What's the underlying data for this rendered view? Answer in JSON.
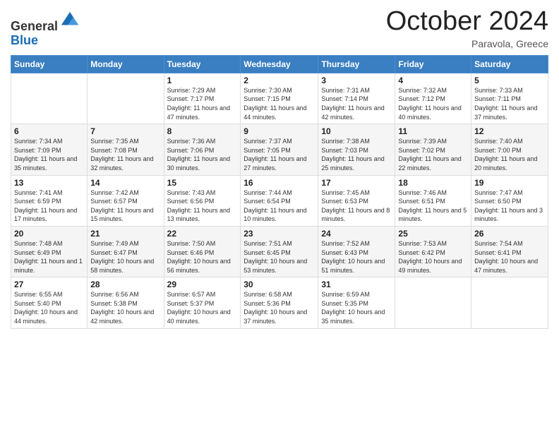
{
  "header": {
    "logo_line1": "General",
    "logo_line2": "Blue",
    "month_title": "October 2024",
    "location": "Paravola, Greece"
  },
  "days_of_week": [
    "Sunday",
    "Monday",
    "Tuesday",
    "Wednesday",
    "Thursday",
    "Friday",
    "Saturday"
  ],
  "weeks": [
    [
      {
        "day": "",
        "info": ""
      },
      {
        "day": "",
        "info": ""
      },
      {
        "day": "1",
        "info": "Sunrise: 7:29 AM\nSunset: 7:17 PM\nDaylight: 11 hours and 47 minutes."
      },
      {
        "day": "2",
        "info": "Sunrise: 7:30 AM\nSunset: 7:15 PM\nDaylight: 11 hours and 44 minutes."
      },
      {
        "day": "3",
        "info": "Sunrise: 7:31 AM\nSunset: 7:14 PM\nDaylight: 11 hours and 42 minutes."
      },
      {
        "day": "4",
        "info": "Sunrise: 7:32 AM\nSunset: 7:12 PM\nDaylight: 11 hours and 40 minutes."
      },
      {
        "day": "5",
        "info": "Sunrise: 7:33 AM\nSunset: 7:11 PM\nDaylight: 11 hours and 37 minutes."
      }
    ],
    [
      {
        "day": "6",
        "info": "Sunrise: 7:34 AM\nSunset: 7:09 PM\nDaylight: 11 hours and 35 minutes."
      },
      {
        "day": "7",
        "info": "Sunrise: 7:35 AM\nSunset: 7:08 PM\nDaylight: 11 hours and 32 minutes."
      },
      {
        "day": "8",
        "info": "Sunrise: 7:36 AM\nSunset: 7:06 PM\nDaylight: 11 hours and 30 minutes."
      },
      {
        "day": "9",
        "info": "Sunrise: 7:37 AM\nSunset: 7:05 PM\nDaylight: 11 hours and 27 minutes."
      },
      {
        "day": "10",
        "info": "Sunrise: 7:38 AM\nSunset: 7:03 PM\nDaylight: 11 hours and 25 minutes."
      },
      {
        "day": "11",
        "info": "Sunrise: 7:39 AM\nSunset: 7:02 PM\nDaylight: 11 hours and 22 minutes."
      },
      {
        "day": "12",
        "info": "Sunrise: 7:40 AM\nSunset: 7:00 PM\nDaylight: 11 hours and 20 minutes."
      }
    ],
    [
      {
        "day": "13",
        "info": "Sunrise: 7:41 AM\nSunset: 6:59 PM\nDaylight: 11 hours and 17 minutes."
      },
      {
        "day": "14",
        "info": "Sunrise: 7:42 AM\nSunset: 6:57 PM\nDaylight: 11 hours and 15 minutes."
      },
      {
        "day": "15",
        "info": "Sunrise: 7:43 AM\nSunset: 6:56 PM\nDaylight: 11 hours and 13 minutes."
      },
      {
        "day": "16",
        "info": "Sunrise: 7:44 AM\nSunset: 6:54 PM\nDaylight: 11 hours and 10 minutes."
      },
      {
        "day": "17",
        "info": "Sunrise: 7:45 AM\nSunset: 6:53 PM\nDaylight: 11 hours and 8 minutes."
      },
      {
        "day": "18",
        "info": "Sunrise: 7:46 AM\nSunset: 6:51 PM\nDaylight: 11 hours and 5 minutes."
      },
      {
        "day": "19",
        "info": "Sunrise: 7:47 AM\nSunset: 6:50 PM\nDaylight: 11 hours and 3 minutes."
      }
    ],
    [
      {
        "day": "20",
        "info": "Sunrise: 7:48 AM\nSunset: 6:49 PM\nDaylight: 11 hours and 1 minute."
      },
      {
        "day": "21",
        "info": "Sunrise: 7:49 AM\nSunset: 6:47 PM\nDaylight: 10 hours and 58 minutes."
      },
      {
        "day": "22",
        "info": "Sunrise: 7:50 AM\nSunset: 6:46 PM\nDaylight: 10 hours and 56 minutes."
      },
      {
        "day": "23",
        "info": "Sunrise: 7:51 AM\nSunset: 6:45 PM\nDaylight: 10 hours and 53 minutes."
      },
      {
        "day": "24",
        "info": "Sunrise: 7:52 AM\nSunset: 6:43 PM\nDaylight: 10 hours and 51 minutes."
      },
      {
        "day": "25",
        "info": "Sunrise: 7:53 AM\nSunset: 6:42 PM\nDaylight: 10 hours and 49 minutes."
      },
      {
        "day": "26",
        "info": "Sunrise: 7:54 AM\nSunset: 6:41 PM\nDaylight: 10 hours and 47 minutes."
      }
    ],
    [
      {
        "day": "27",
        "info": "Sunrise: 6:55 AM\nSunset: 5:40 PM\nDaylight: 10 hours and 44 minutes."
      },
      {
        "day": "28",
        "info": "Sunrise: 6:56 AM\nSunset: 5:38 PM\nDaylight: 10 hours and 42 minutes."
      },
      {
        "day": "29",
        "info": "Sunrise: 6:57 AM\nSunset: 5:37 PM\nDaylight: 10 hours and 40 minutes."
      },
      {
        "day": "30",
        "info": "Sunrise: 6:58 AM\nSunset: 5:36 PM\nDaylight: 10 hours and 37 minutes."
      },
      {
        "day": "31",
        "info": "Sunrise: 6:59 AM\nSunset: 5:35 PM\nDaylight: 10 hours and 35 minutes."
      },
      {
        "day": "",
        "info": ""
      },
      {
        "day": "",
        "info": ""
      }
    ]
  ]
}
